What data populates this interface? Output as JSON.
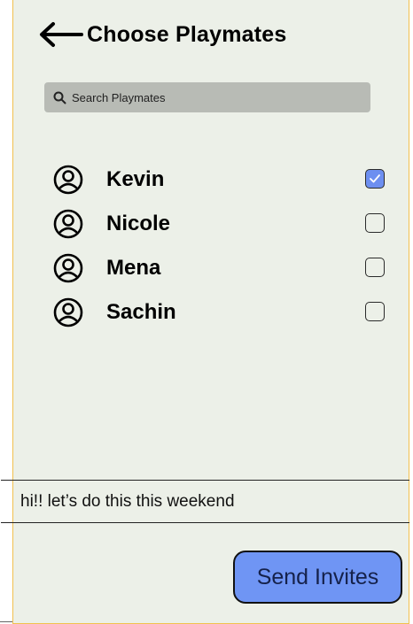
{
  "header": {
    "title": "Choose Playmates",
    "back_icon": "arrow-left-icon"
  },
  "search": {
    "placeholder": "Search Playmates",
    "icon": "search-icon"
  },
  "playmates": [
    {
      "name": "Kevin",
      "checked": true
    },
    {
      "name": "Nicole",
      "checked": false
    },
    {
      "name": "Mena",
      "checked": false
    },
    {
      "name": "Sachin",
      "checked": false
    }
  ],
  "message": {
    "text": "hi!! let’s do this this weekend"
  },
  "actions": {
    "send_label": "Send Invites"
  },
  "colors": {
    "background": "#ecf0e8",
    "frame_border": "#f2c14e",
    "search_bg": "#b8bbb5",
    "accent": "#6f95f4"
  }
}
